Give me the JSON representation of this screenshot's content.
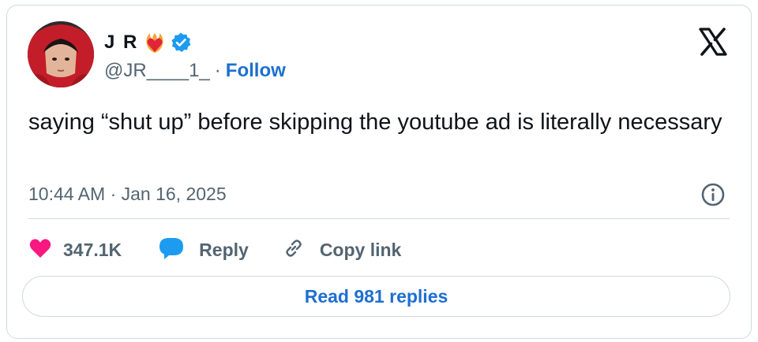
{
  "author": {
    "display_name": "J R",
    "handle": "@JR____1_",
    "separator": "·",
    "follow_label": "Follow",
    "emoji_icon": "heart-on-fire-icon",
    "verified_icon": "verified-badge-icon"
  },
  "tweet": {
    "text": "saying “shut up” before skipping the youtube ad is literally necessary",
    "timestamp": "10:44 AM · Jan 16, 2025"
  },
  "actions": {
    "like_count": "347.1K",
    "reply_label": "Reply",
    "copy_link_label": "Copy link"
  },
  "footer": {
    "read_replies_label": "Read 981 replies"
  },
  "colors": {
    "text": "#0f1419",
    "secondary": "#536471",
    "link": "#1d6fd0",
    "like": "#f91880",
    "reply": "#1d9bf0",
    "border": "#cfd9de"
  }
}
